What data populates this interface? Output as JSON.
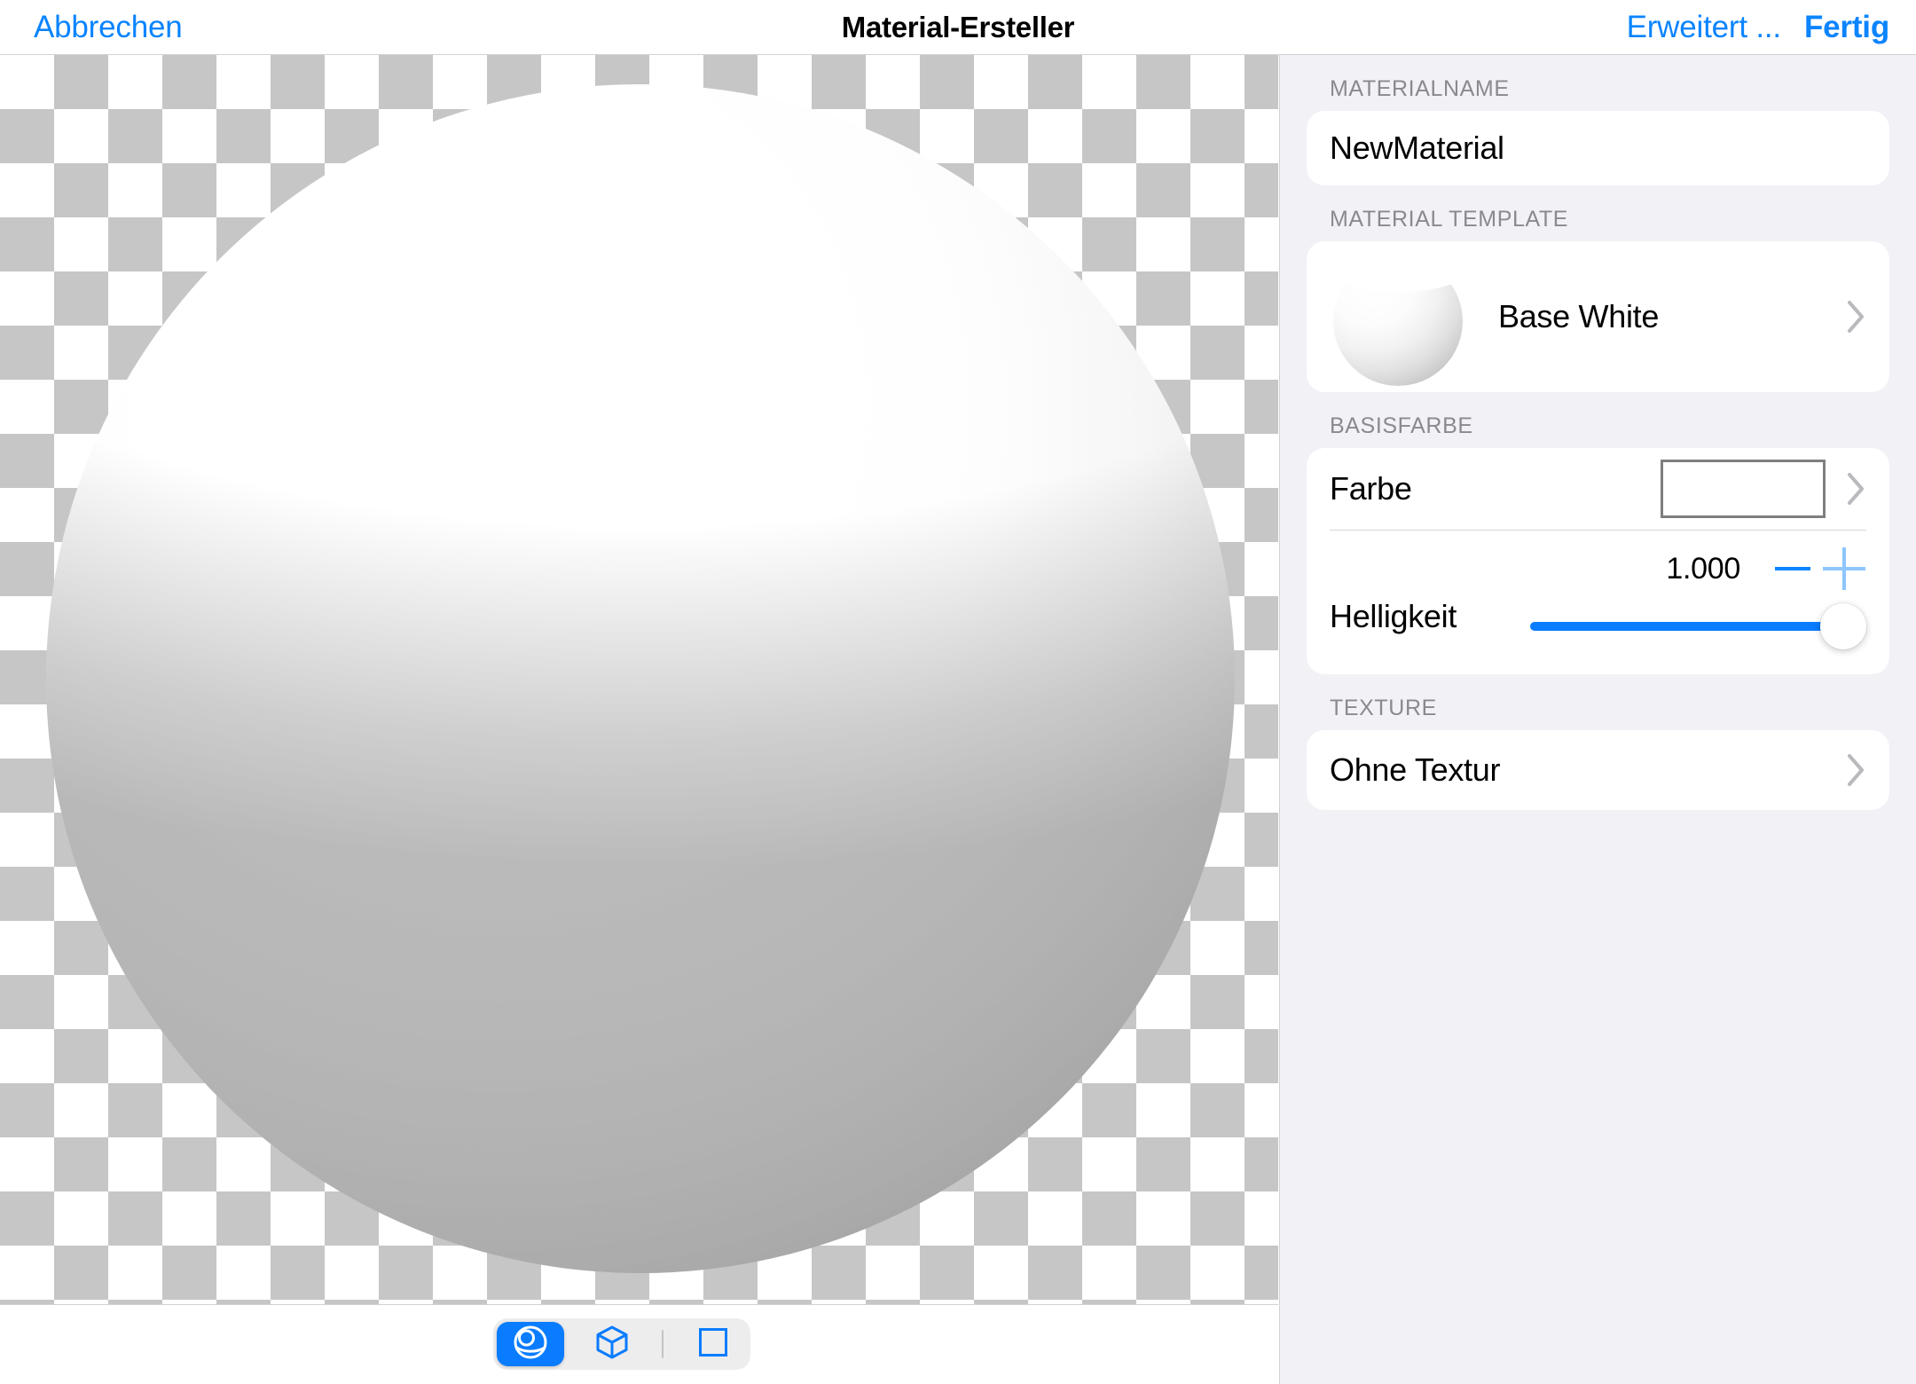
{
  "header": {
    "cancel_label": "Abbrechen",
    "title": "Material-Ersteller",
    "advanced_label": "Erweitert ...",
    "done_label": "Fertig"
  },
  "viewport": {
    "preview_shape": "sphere",
    "background": "transparency-checkerboard"
  },
  "shape_toolbar": {
    "options": [
      {
        "id": "sphere",
        "icon": "sphere-icon",
        "selected": true
      },
      {
        "id": "cube",
        "icon": "cube-icon",
        "selected": false
      },
      {
        "id": "plane",
        "icon": "square-icon",
        "selected": false
      }
    ]
  },
  "panel": {
    "sections": {
      "material_name": {
        "label": "MATERIALNAME",
        "value": "NewMaterial",
        "placeholder": "NewMaterial"
      },
      "material_template": {
        "label": "MATERIAL TEMPLATE",
        "value": "Base White",
        "thumbnail": "sphere-thumbnail"
      },
      "base_color": {
        "label": "BASISFARBE",
        "color_row_label": "Farbe",
        "color_value": "#FFFFFF",
        "brightness_row_label": "Helligkeit",
        "brightness_value": "1.000",
        "brightness_percent": 100,
        "minus_label": "−",
        "plus_label": "+"
      },
      "texture": {
        "label": "TEXTURE",
        "value": "Ohne Textur"
      }
    }
  },
  "colors": {
    "accent_blue": "#0A84FF",
    "panel_background": "#F1F1F6",
    "card_background": "#FFFFFF",
    "section_label": "#8A8A8E",
    "checker_gray": "#C6C6C6"
  }
}
